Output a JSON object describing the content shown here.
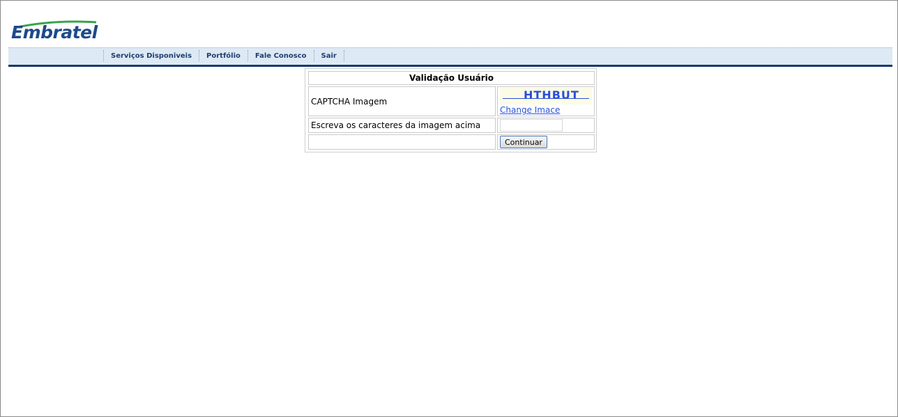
{
  "logo": {
    "text": "Embratel"
  },
  "nav": {
    "items": [
      {
        "label": "Serviços Disponiveis"
      },
      {
        "label": "Portfólio"
      },
      {
        "label": "Fale Conosco"
      },
      {
        "label": "Sair"
      }
    ]
  },
  "form": {
    "title": "Validação Usuário",
    "captcha_label": "CAPTCHA Imagem",
    "captcha_text": "HTHBUT",
    "change_image_label": "Change Imace",
    "chars_label": "Escreva os caracteres da imagem acima",
    "chars_value": "",
    "submit_label": "Continuar"
  },
  "colors": {
    "brand": "#1e4a8a",
    "nav_bg": "#dde9f4",
    "nav_bar": "#1a3a6b",
    "link": "#2a52d6"
  }
}
